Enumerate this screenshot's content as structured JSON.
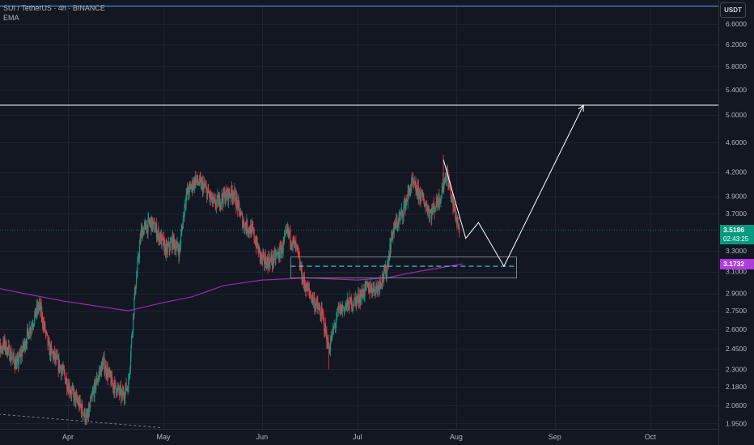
{
  "header": {
    "symbol_line": "SUI / TetherUS · 4h · BINANCE",
    "indicator": "EMA"
  },
  "currency_badge": "USDT",
  "last_price": {
    "value": "3.5186",
    "countdown": "02:43:25"
  },
  "ema_value": "3.1732",
  "colors": {
    "background": "#131722",
    "up": "#089981",
    "down": "#f23645",
    "ema": "#9c27b0",
    "drawing": "#ffffff",
    "zone_dash": "#4dd0e1"
  },
  "chart_data": {
    "type": "candlestick",
    "y_scale": "log",
    "ylim": [
      1.93,
      7.0
    ],
    "y_ticks": [
      "6.6000",
      "6.2000",
      "5.8000",
      "5.4000",
      "5.0000",
      "4.6000",
      "4.2000",
      "3.9000",
      "3.7000",
      "3.3000",
      "3.1000",
      "2.9000",
      "2.7500",
      "2.6000",
      "2.4500",
      "2.3000",
      "2.1800",
      "2.0600",
      "1.9500"
    ],
    "x_ticks": [
      "Apr",
      "May",
      "Jun",
      "Jul",
      "Aug",
      "Sep",
      "Oct"
    ],
    "price_path": [
      {
        "date": "2025-03-08",
        "price": 2.38
      },
      {
        "date": "2025-03-12",
        "price": 2.48
      },
      {
        "date": "2025-03-16",
        "price": 2.33
      },
      {
        "date": "2025-03-20",
        "price": 2.6
      },
      {
        "date": "2025-03-23",
        "price": 2.8
      },
      {
        "date": "2025-03-26",
        "price": 2.45
      },
      {
        "date": "2025-03-30",
        "price": 2.3
      },
      {
        "date": "2025-04-02",
        "price": 2.15
      },
      {
        "date": "2025-04-05",
        "price": 2.05
      },
      {
        "date": "2025-04-07",
        "price": 1.97
      },
      {
        "date": "2025-04-09",
        "price": 2.15
      },
      {
        "date": "2025-04-12",
        "price": 2.35
      },
      {
        "date": "2025-04-15",
        "price": 2.2
      },
      {
        "date": "2025-04-18",
        "price": 2.12
      },
      {
        "date": "2025-04-20",
        "price": 2.2
      },
      {
        "date": "2025-04-22",
        "price": 2.9
      },
      {
        "date": "2025-04-24",
        "price": 3.5
      },
      {
        "date": "2025-04-27",
        "price": 3.6
      },
      {
        "date": "2025-04-29",
        "price": 3.5
      },
      {
        "date": "2025-05-02",
        "price": 3.3
      },
      {
        "date": "2025-05-04",
        "price": 3.4
      },
      {
        "date": "2025-05-06",
        "price": 3.3
      },
      {
        "date": "2025-05-08",
        "price": 3.9
      },
      {
        "date": "2025-05-11",
        "price": 4.1
      },
      {
        "date": "2025-05-14",
        "price": 4.0
      },
      {
        "date": "2025-05-17",
        "price": 3.8
      },
      {
        "date": "2025-05-20",
        "price": 3.9
      },
      {
        "date": "2025-05-23",
        "price": 3.95
      },
      {
        "date": "2025-05-26",
        "price": 3.6
      },
      {
        "date": "2025-05-29",
        "price": 3.5
      },
      {
        "date": "2025-06-01",
        "price": 3.2
      },
      {
        "date": "2025-06-04",
        "price": 3.2
      },
      {
        "date": "2025-06-07",
        "price": 3.3
      },
      {
        "date": "2025-06-09",
        "price": 3.5
      },
      {
        "date": "2025-06-12",
        "price": 3.3
      },
      {
        "date": "2025-06-14",
        "price": 3.0
      },
      {
        "date": "2025-06-17",
        "price": 2.85
      },
      {
        "date": "2025-06-20",
        "price": 2.7
      },
      {
        "date": "2025-06-22",
        "price": 2.45
      },
      {
        "date": "2025-06-25",
        "price": 2.75
      },
      {
        "date": "2025-06-28",
        "price": 2.8
      },
      {
        "date": "2025-07-01",
        "price": 2.85
      },
      {
        "date": "2025-07-04",
        "price": 2.95
      },
      {
        "date": "2025-07-07",
        "price": 2.95
      },
      {
        "date": "2025-07-10",
        "price": 3.1
      },
      {
        "date": "2025-07-12",
        "price": 3.5
      },
      {
        "date": "2025-07-15",
        "price": 3.7
      },
      {
        "date": "2025-07-18",
        "price": 4.05
      },
      {
        "date": "2025-07-21",
        "price": 3.9
      },
      {
        "date": "2025-07-24",
        "price": 3.7
      },
      {
        "date": "2025-07-27",
        "price": 3.9
      },
      {
        "date": "2025-07-29",
        "price": 4.2
      },
      {
        "date": "2025-07-31",
        "price": 3.8
      },
      {
        "date": "2025-08-02",
        "price": 3.5186
      }
    ],
    "swing_high": {
      "date": "2025-07-28",
      "price": 4.43
    },
    "swing_low": {
      "date": "2025-06-22",
      "price": 2.3
    },
    "ema_path": [
      {
        "date": "2025-03-04",
        "price": 2.98
      },
      {
        "date": "2025-03-18",
        "price": 2.9
      },
      {
        "date": "2025-03-31",
        "price": 2.83
      },
      {
        "date": "2025-04-20",
        "price": 2.75
      },
      {
        "date": "2025-05-01",
        "price": 2.82
      },
      {
        "date": "2025-05-10",
        "price": 2.87
      },
      {
        "date": "2025-05-20",
        "price": 2.97
      },
      {
        "date": "2025-06-01",
        "price": 3.02
      },
      {
        "date": "2025-06-15",
        "price": 3.04
      },
      {
        "date": "2025-07-01",
        "price": 3.02
      },
      {
        "date": "2025-07-10",
        "price": 3.04
      },
      {
        "date": "2025-07-20",
        "price": 3.1
      },
      {
        "date": "2025-08-03",
        "price": 3.1732
      }
    ],
    "projection_path": [
      {
        "date": "2025-07-28",
        "price": 4.36
      },
      {
        "date": "2025-08-04",
        "price": 3.43
      },
      {
        "date": "2025-08-08",
        "price": 3.6
      },
      {
        "date": "2025-08-16",
        "price": 3.15
      },
      {
        "date": "2025-09-10",
        "price": 5.15
      }
    ],
    "resistance_level": 5.15,
    "support_zone": {
      "from_date": "2025-06-10",
      "to_date": "2025-08-20",
      "low": 3.04,
      "high": 3.24,
      "mid": 3.15
    },
    "dashed_trendline": [
      {
        "date": "2025-03-01",
        "price": 2.02
      },
      {
        "date": "2025-04-30",
        "price": 1.925
      }
    ],
    "last_price": 3.5186,
    "ema_last": 3.1732
  }
}
